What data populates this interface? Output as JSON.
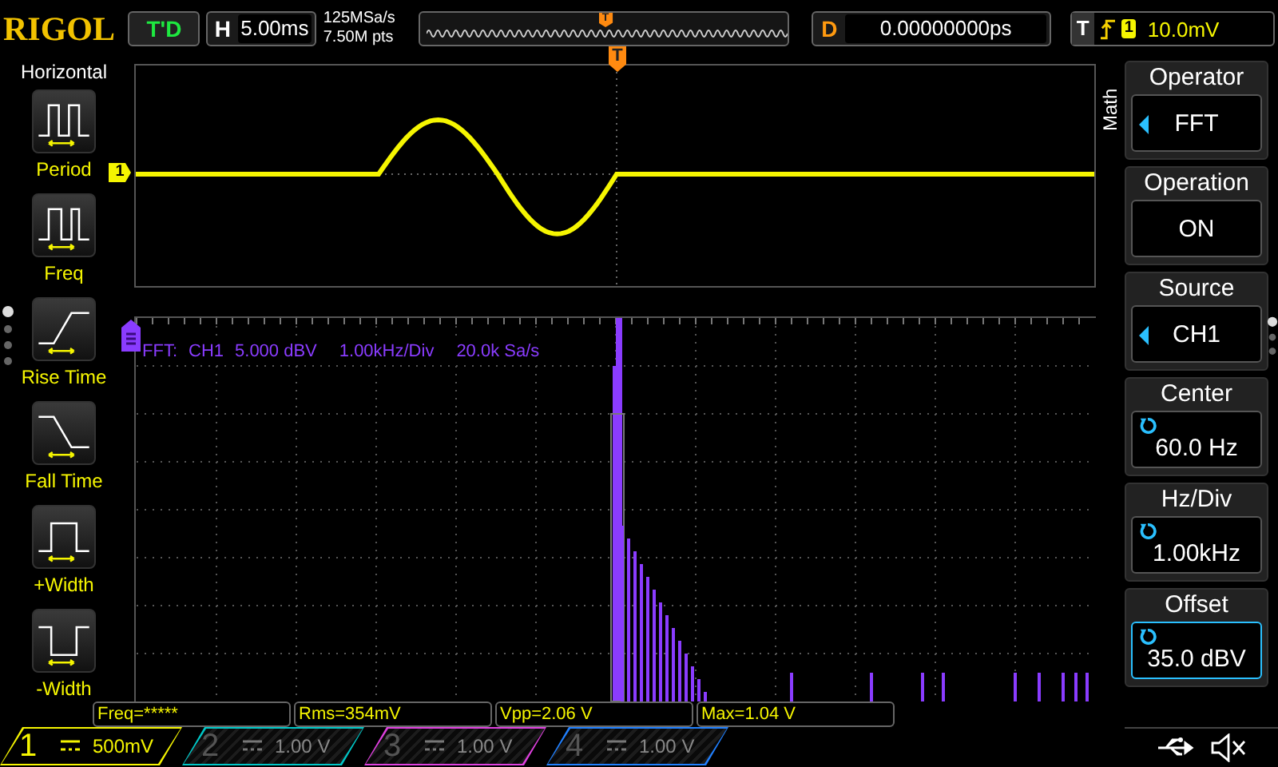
{
  "brand": "RIGOL",
  "run_state": "T'D",
  "horizontal": {
    "label": "H",
    "timebase": "5.00ms",
    "sample_rate": "125MSa/s",
    "memory_depth": "7.50M pts",
    "trigger_marker": "T"
  },
  "delay": {
    "label": "D",
    "value": "0.00000000ps"
  },
  "trigger": {
    "label": "T",
    "source": "1",
    "level": "10.0mV"
  },
  "left_menu": {
    "title": "Horizontal",
    "items": [
      {
        "label": "Period",
        "kind": "period"
      },
      {
        "label": "Freq",
        "kind": "freq"
      },
      {
        "label": "Rise Time",
        "kind": "rise"
      },
      {
        "label": "Fall Time",
        "kind": "fall"
      },
      {
        "label": "+Width",
        "kind": "pwidth"
      },
      {
        "label": "-Width",
        "kind": "nwidth"
      }
    ]
  },
  "waveform": {
    "channel_marker": "1",
    "trigger_marker": "T"
  },
  "fft": {
    "info": [
      "FFT:",
      "CH1",
      "5.000 dBV",
      "1.00kHz/Div",
      "20.0k Sa/s"
    ]
  },
  "measurements": [
    "Freq=*****",
    "Rms=354mV",
    "Vpp=2.06 V",
    "Max=1.04 V"
  ],
  "channels": [
    {
      "number": "1",
      "scale": "500mV",
      "on": true,
      "color": "#f5f500"
    },
    {
      "number": "2",
      "scale": "1.00 V",
      "on": false,
      "color": "#00c8c8"
    },
    {
      "number": "3",
      "scale": "1.00 V",
      "on": false,
      "color": "#e040e0"
    },
    {
      "number": "4",
      "scale": "1.00 V",
      "on": false,
      "color": "#2080ff"
    }
  ],
  "right_menu": {
    "title": "Math",
    "items": [
      {
        "label": "Operator",
        "value": "FFT",
        "kind": "select",
        "selected": false
      },
      {
        "label": "Operation",
        "value": "ON",
        "kind": "plain",
        "selected": false
      },
      {
        "label": "Source",
        "value": "CH1",
        "kind": "select",
        "selected": false
      },
      {
        "label": "Center",
        "value": "60.0 Hz",
        "kind": "knob",
        "selected": false
      },
      {
        "label": "Hz/Div",
        "value": "1.00kHz",
        "kind": "knob",
        "selected": false
      },
      {
        "label": "Offset",
        "value": "35.0 dBV",
        "kind": "knob",
        "selected": true
      }
    ]
  }
}
